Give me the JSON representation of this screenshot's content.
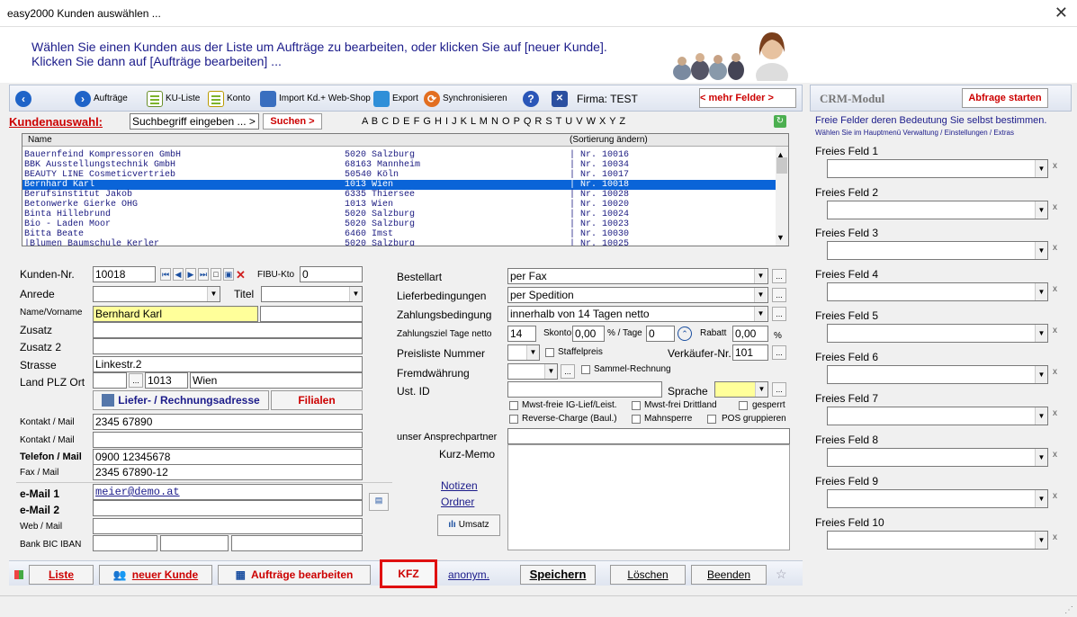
{
  "window": {
    "title": "easy2000 Kunden auswählen ...",
    "close": "✕"
  },
  "banner": {
    "line1": "Wählen Sie einen Kunden aus der Liste um Aufträge zu bearbeiten, oder klicken Sie auf [neuer Kunde].",
    "line2": "Klicken Sie dann auf [Aufträge bearbeiten] ..."
  },
  "toolbar": {
    "auftraege": "Aufträge",
    "kuliste": "KU-Liste",
    "konto": "Konto",
    "import": "Import Kd.+ Web-Shop",
    "export": "Export",
    "sync": "Synchronisieren",
    "firma": "Firma: TEST",
    "mehr": "< mehr Felder >"
  },
  "crm": {
    "title": "CRM-Modul",
    "query": "Abfrage starten",
    "info1": "Freie Felder deren Bedeutung Sie selbst bestimmen.",
    "info2": "Wählen Sie im Hauptmenü Verwaltung / Einstellungen / Extras",
    "x": "x"
  },
  "search": {
    "label": "Kundenauswahl:",
    "input": "Suchbegriff eingeben ... >",
    "button": "Suchen >",
    "alphabet": "A B C D E F G H I J K L M N O P Q R S T U V W X Y Z"
  },
  "list": {
    "col_name": "Name",
    "col_sort": "(Sortierung ändern)",
    "rows": [
      {
        "name": "Bauernfeind Kompressoren GmbH",
        "city": "5020 Salzburg",
        "nr": "| Nr. 10016"
      },
      {
        "name": "BBK Ausstellungstechnik GmbH",
        "city": "68163 Mannheim",
        "nr": "| Nr. 10034"
      },
      {
        "name": "BEAUTY LINE Cosmeticvertrieb",
        "city": "50540 Köln",
        "nr": "| Nr. 10017"
      },
      {
        "name": "Bernhard Karl",
        "city": "1013 Wien",
        "nr": "| Nr. 10018"
      },
      {
        "name": "Berufsinstitut Jakob",
        "city": "6335 Thiersee",
        "nr": "| Nr. 10028"
      },
      {
        "name": "Betonwerke Gierke OHG",
        "city": "1013 Wien",
        "nr": "| Nr. 10020"
      },
      {
        "name": "Binta Hillebrund",
        "city": "5020 Salzburg",
        "nr": "| Nr. 10024"
      },
      {
        "name": "Bio - Laden Moor",
        "city": "5020 Salzburg",
        "nr": "| Nr. 10023"
      },
      {
        "name": "Bitta Beate",
        "city": "6460 Imst",
        "nr": "| Nr. 10030"
      },
      {
        "name": "|Blumen Baumschule Kerler",
        "city": "5020 Salzburg",
        "nr": "| Nr. 10025"
      }
    ]
  },
  "form": {
    "kundennr_label": "Kunden-Nr.",
    "kundennr": "10018",
    "fibu_label": "FIBU-Kto",
    "fibu": "0",
    "anrede_label": "Anrede",
    "titel_label": "Titel",
    "name_label": "Name/Vorname",
    "name": "Bernhard Karl",
    "zusatz_label": "Zusatz",
    "zusatz2_label": "Zusatz 2",
    "strasse_label": "Strasse",
    "strasse": "Linkestr.2",
    "plz_label": "Land PLZ Ort",
    "plz": "1013",
    "ort": "Wien",
    "liefer_btn": "Liefer- / Rechnungsadresse",
    "filialen_btn": "Filialen",
    "kontakt1_label": "Kontakt / Mail",
    "kontakt1": "2345 67890",
    "kontakt2_label": "Kontakt / Mail",
    "telefon_label": "Telefon / Mail",
    "telefon": "0900 12345678",
    "fax_label": "Fax / Mail",
    "fax": "2345 67890-12",
    "email1_label": "e-Mail 1",
    "email1": "meier@demo.at",
    "email2_label": "e-Mail 2",
    "web_label": "Web / Mail",
    "bank_label": "Bank BIC IBAN",
    "ellipsis": "..."
  },
  "order": {
    "bestellart_label": "Bestellart",
    "bestellart": "per Fax",
    "liefer_label": "Lieferbedingungen",
    "liefer": "per Spedition",
    "zahlung_label": "Zahlungsbedingung",
    "zahlung": "innerhalb von 14 Tagen netto",
    "ziel_label": "Zahlungsziel Tage netto",
    "ziel": "14",
    "skonto_label": "Skonto",
    "skonto": "0,00",
    "pct_tage": "% / Tage",
    "tage": "0",
    "rabatt_label": "Rabatt",
    "rabatt": "0,00",
    "pct": "%",
    "preisliste_label": "Preisliste Nummer",
    "staffel": "Staffelpreis",
    "verk_label": "Verkäufer-Nr.",
    "verk": "101",
    "fremd_label": "Fremdwährung",
    "sammel": "Sammel-Rechnung",
    "ust_label": "Ust. ID",
    "sprache_label": "Sprache",
    "mwst_ig": "Mwst-freie IG-Lief/Leist.",
    "mwst_dritt": "Mwst-frei Drittland",
    "gesperrt": "gesperrt",
    "reverse": "Reverse-Charge (Baul.)",
    "mahnsperre": "Mahnsperre",
    "pos": "POS gruppieren",
    "ansprech_label": "unser Ansprechpartner",
    "memo_label": "Kurz-Memo",
    "notizen": "Notizen",
    "ordner": "Ordner",
    "umsatz": "Umsatz"
  },
  "freie": [
    "Freies Feld 1",
    "Freies Feld 2",
    "Freies Feld 3",
    "Freies Feld 4",
    "Freies Feld 5",
    "Freies Feld 6",
    "Freies Feld 7",
    "Freies Feld 8",
    "Freies Feld 9",
    "Freies Feld 10"
  ],
  "bottom": {
    "liste": "Liste",
    "neu": "neuer Kunde",
    "auftr": "Aufträge bearbeiten",
    "kfz": "KFZ",
    "anonym": "anonym.",
    "speichern": "Speichern",
    "loeschen": "Löschen",
    "beenden": "Beenden"
  },
  "colors": {
    "accent_red": "#c00000",
    "highlight_yellow": "#ffff9a",
    "selection_blue": "#0a64d8",
    "banner_text": "#1b1b8a"
  }
}
